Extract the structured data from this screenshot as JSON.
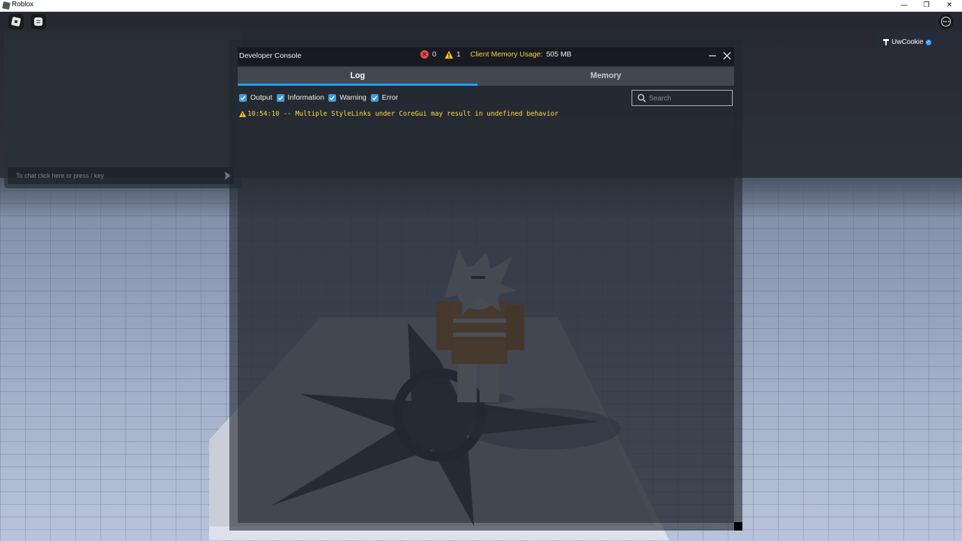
{
  "window": {
    "title": "Roblox",
    "minimize_glyph": "—",
    "restore_glyph": "❐",
    "close_glyph": "✕"
  },
  "chat": {
    "placeholder": "To chat click here or press / key"
  },
  "player_list": {
    "players": [
      {
        "name": "UwCookie",
        "verified": true
      }
    ]
  },
  "dev_console": {
    "title": "Developer Console",
    "error_count": "0",
    "warning_count": "1",
    "memory_label": "Client Memory Usage:",
    "memory_value": "505 MB",
    "tabs": [
      {
        "label": "Log",
        "active": true
      },
      {
        "label": "Memory",
        "active": false
      }
    ],
    "filters": [
      {
        "label": "Output",
        "checked": true
      },
      {
        "label": "Information",
        "checked": true
      },
      {
        "label": "Warning",
        "checked": true
      },
      {
        "label": "Error",
        "checked": true
      }
    ],
    "search_placeholder": "Search",
    "log_entries": [
      {
        "level": "warning",
        "text": "10:54:10 -- Multiple StyleLinks under CoreGui may result in undefined behavior"
      }
    ]
  },
  "colors": {
    "accent": "#1aa3ff",
    "warning": "#ffd84a",
    "error": "#e34a4a",
    "checkbox": "#3f9bd8"
  },
  "icons": [
    "roblox-menu-icon",
    "chat-toggle-icon",
    "more-options-icon",
    "send-icon",
    "premium-icon",
    "verified-icon",
    "error-icon",
    "warning-icon",
    "minimize-icon",
    "close-icon",
    "search-icon",
    "checkbox-check-icon"
  ]
}
